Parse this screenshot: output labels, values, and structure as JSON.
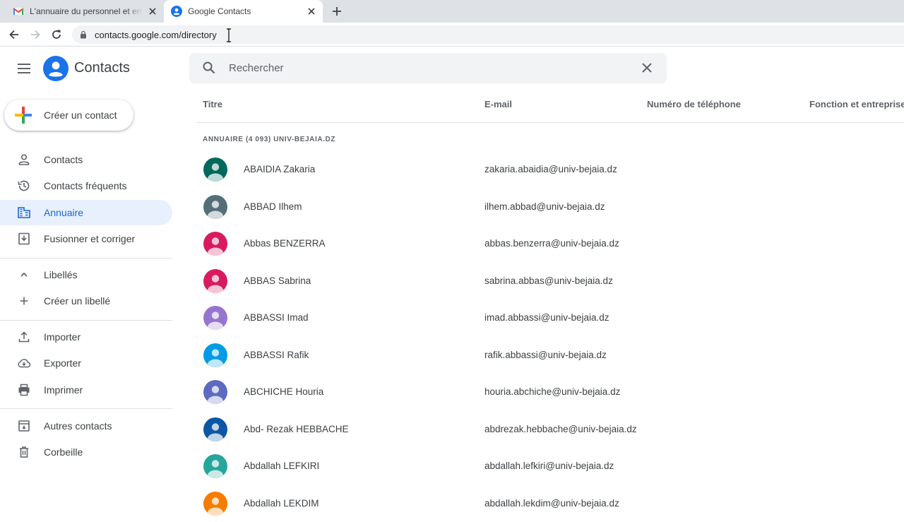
{
  "browser": {
    "tabs": [
      {
        "title": "L'annuaire du personnel et email",
        "favicon": "gmail-icon",
        "active": false
      },
      {
        "title": "Google Contacts",
        "favicon": "contacts-icon",
        "active": true
      }
    ],
    "url": "contacts.google.com/directory"
  },
  "app": {
    "name": "Contacts",
    "brand_color": "#1a73e8"
  },
  "search": {
    "placeholder": "Rechercher",
    "value": ""
  },
  "sidebar": {
    "create_label": "Créer un contact",
    "items": [
      {
        "label": "Contacts",
        "icon": "person-icon"
      },
      {
        "label": "Contacts fréquents",
        "icon": "history-icon"
      },
      {
        "label": "Annuaire",
        "icon": "domain-icon",
        "active": true
      },
      {
        "label": "Fusionner et corriger",
        "icon": "merge-icon"
      },
      {
        "label": "Libellés",
        "icon": "chevron-up-icon"
      },
      {
        "label": "Créer un libellé",
        "icon": "plus-icon"
      },
      {
        "label": "Importer",
        "icon": "upload-icon"
      },
      {
        "label": "Exporter",
        "icon": "cloud-download-icon"
      },
      {
        "label": "Imprimer",
        "icon": "print-icon"
      },
      {
        "label": "Autres contacts",
        "icon": "archive-icon"
      },
      {
        "label": "Corbeille",
        "icon": "trash-icon"
      }
    ]
  },
  "table": {
    "columns": [
      "Titre",
      "E-mail",
      "Numéro de téléphone",
      "Fonction et entreprise"
    ],
    "section_label": "ANNUAIRE (4 093) UNIV-BEJAIA.DZ",
    "rows": [
      {
        "name": "ABAIDIA Zakaria",
        "email": "zakaria.abaidia@univ-bejaia.dz",
        "avatar_color": "#00695c"
      },
      {
        "name": "ABBAD Ilhem",
        "email": "ilhem.abbad@univ-bejaia.dz",
        "avatar_color": "#546e7a"
      },
      {
        "name": "Abbas BENZERRA",
        "email": "abbas.benzerra@univ-bejaia.dz",
        "avatar_color": "#d81b60"
      },
      {
        "name": "ABBAS Sabrina",
        "email": "sabrina.abbas@univ-bejaia.dz",
        "avatar_color": "#d81b60"
      },
      {
        "name": "ABBASSI Imad",
        "email": "imad.abbassi@univ-bejaia.dz",
        "avatar_color": "#9575cd"
      },
      {
        "name": "ABBASSI Rafik",
        "email": "rafik.abbassi@univ-bejaia.dz",
        "avatar_color": "#039be5"
      },
      {
        "name": "ABCHICHE Houria",
        "email": "houria.abchiche@univ-bejaia.dz",
        "avatar_color": "#5c6bc0"
      },
      {
        "name": "Abd- Rezak HEBBACHE",
        "email": "abdrezak.hebbache@univ-bejaia.dz",
        "avatar_color": "#0b57a4"
      },
      {
        "name": "Abdallah LEFKIRI",
        "email": "abdallah.lefkiri@univ-bejaia.dz",
        "avatar_color": "#26a69a"
      },
      {
        "name": "Abdallah LEKDIM",
        "email": "abdallah.lekdim@univ-bejaia.dz",
        "avatar_color": "#f57c00"
      }
    ]
  }
}
